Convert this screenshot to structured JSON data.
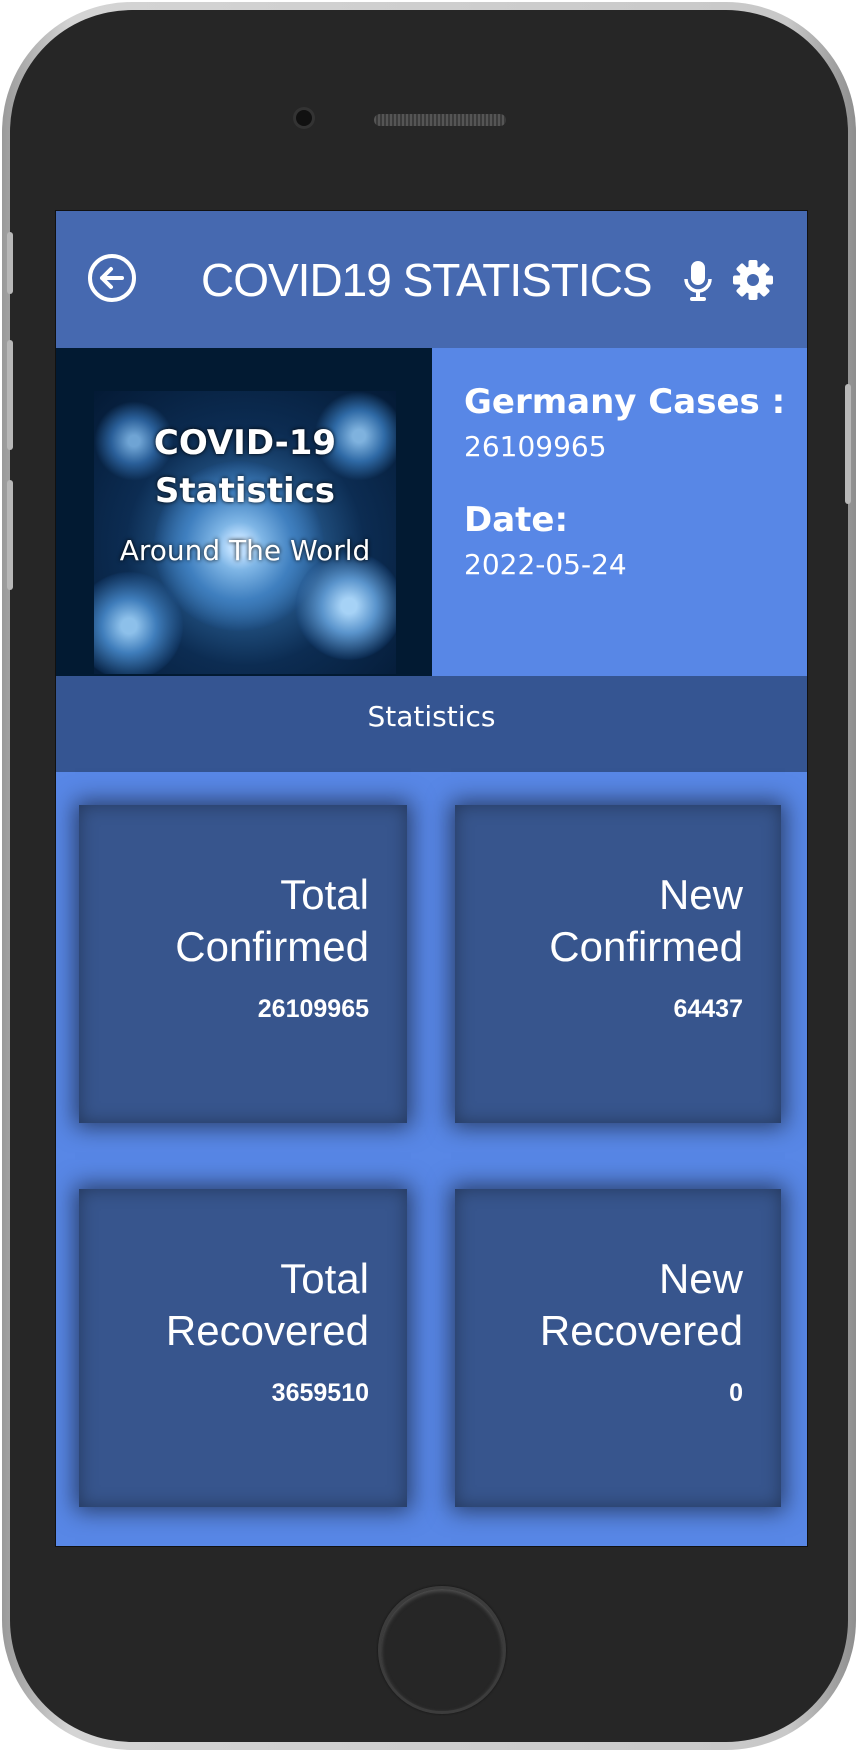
{
  "app": {
    "title": "COVID19 STATISTICS"
  },
  "icons": {
    "back": "back-arrow-circle-icon",
    "mic": "microphone-icon",
    "settings": "gear-icon"
  },
  "hero": {
    "image_title_line1": "COVID-19",
    "image_title_line2": "Statistics",
    "image_subtitle": "Around The World"
  },
  "summary": {
    "cases_label": "Germany Cases :",
    "cases_value": "26109965",
    "date_label": "Date:",
    "date_value": "2022-05-24"
  },
  "section": {
    "label": "Statistics"
  },
  "cards": [
    {
      "line1": "Total",
      "line2": "Confirmed",
      "value": "26109965"
    },
    {
      "line1": "New",
      "line2": "Confirmed",
      "value": "64437"
    },
    {
      "line1": "Total",
      "line2": "Recovered",
      "value": "3659510"
    },
    {
      "line1": "New",
      "line2": "Recovered",
      "value": "0"
    }
  ],
  "colors": {
    "appbar": "#4669b0",
    "accent": "#5887e6",
    "card": "#37558d",
    "stats_bar": "#355592"
  }
}
